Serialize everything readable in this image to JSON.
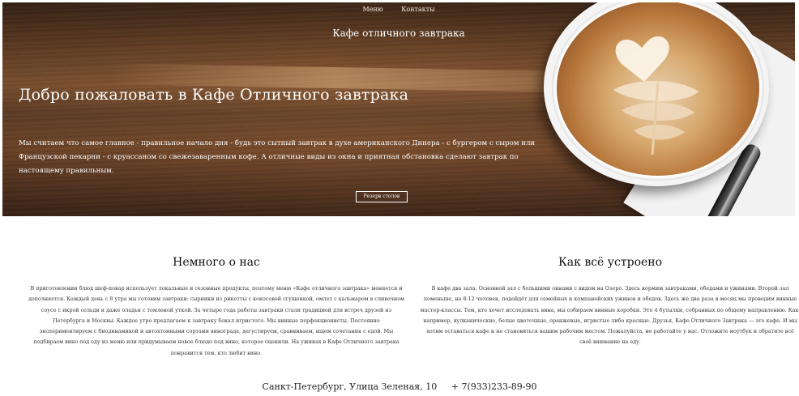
{
  "nav": {
    "items": [
      "Меню",
      "Контакты"
    ]
  },
  "brand": "Кафе отличного завтрака",
  "hero": {
    "title": "Добро пожаловать в Кафе Отличного завтрака",
    "text": "Мы считаем что самое главное - правильное начало дня - будь это сытный завтрак в духе американского Динера - с бургером с сыром или Французской пекарни - с круассаном со свежезаваренным кофе. А отличные виды из окна и приятная обстановка сделают завтрак по настоящему правильным.",
    "reserve_label": "Резерв столов"
  },
  "about": {
    "title": "Немного о нас",
    "text": "В приготовлении блюд шеф-повар использует локальные и сезонные продукты, поэтому меню «Кафе отличного завтрака» меняется и дополняется. Каждый день с 8 утра мы готовим завтраки: сырники из рикотты с кокосовой сгущенкой, омлет с кальмаром в сливочном соусе с икрой сельди и даже оладьи с томленой уткой. За четыре года работы завтраки стали традицией для встреч друзей из Петербурга и Москвы. Каждое утро предлагаем к завтраку бокал игристого. Мы винные перфекционисты. Постоянно экспериментируем с биодинамикой и автохтонными сортами винограда, дегустируем, сравниваем, ищем сочетания с едой. Мы подбираем вино под еду из меню или придумываем новое блюдо под вино, которое оценили. На ужинах в Кафе Отличного завтрака понравится тем, кто любит вино."
  },
  "how": {
    "title": "Как всё устроено",
    "text": "В кафе два зала. Основной зал с большими окнами с видом на Озеро. Здесь кормим завтраками, обедами и ужинами. Второй зал поменьше, на 8-12 человек, подойдёт для семейных и компанейских ужинов и обедов. Здесь же два раза в месяц мы проводим винные мастер-классы. Тем, кто хочет исследовать вина, мы собираем винные коробки. Это 4 бутылки, собранных по общему направлению. Как, например, вулканические, белые цветочные, оранжевые, игристые либо красные. Друзья, Кафе Отличного Завтрака — это кафе. И мы хотим оставаться кафе и не становиться вашим рабочим местом. Пожалуйста, не работайте у нас. Отложите ноутбук и обратите всё своё внимание на еду."
  },
  "footer": {
    "address": "Санкт-Петербург, Улица Зеленая, 10",
    "phone": "+ 7(933)233-89-90"
  }
}
